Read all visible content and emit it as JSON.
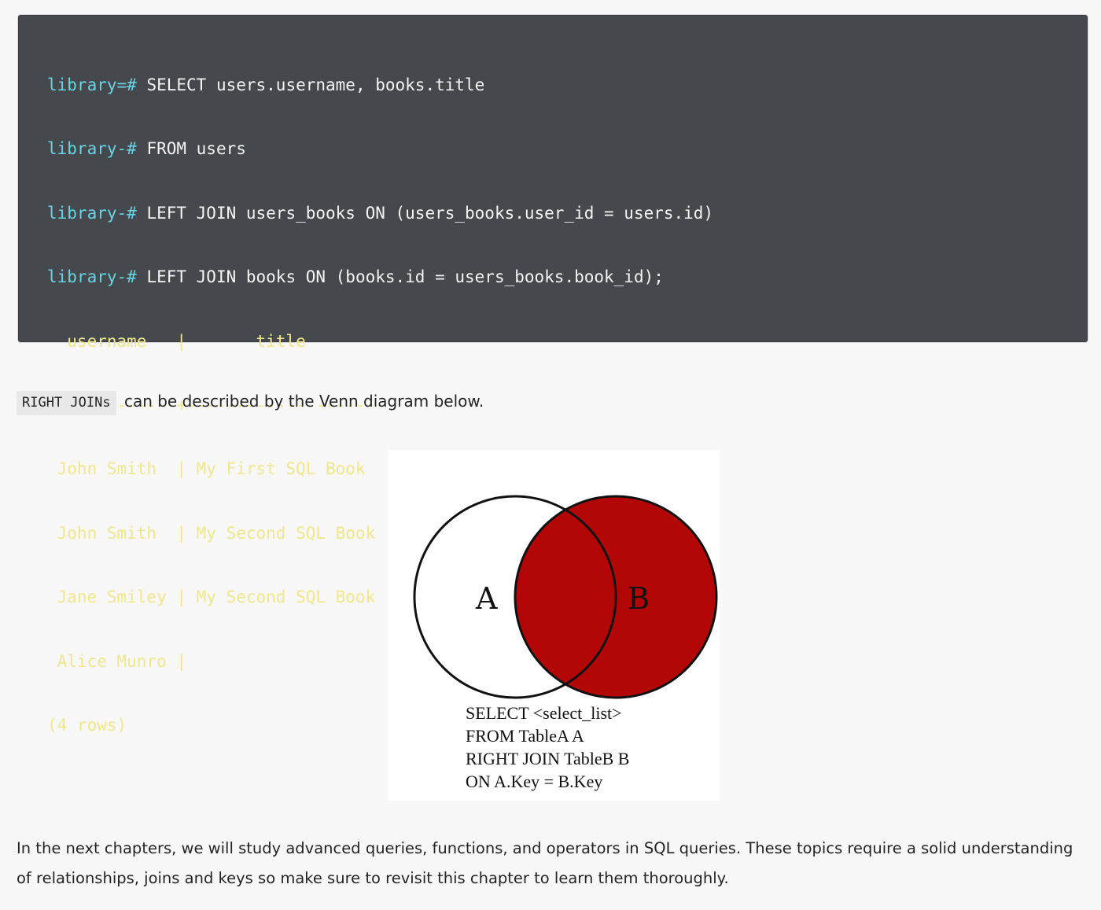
{
  "code_block": {
    "lines": [
      {
        "prompt": "library=#",
        "text": " SELECT users.username, books.title",
        "kind": "sql"
      },
      {
        "prompt": "library-#",
        "text": " FROM users",
        "kind": "sql"
      },
      {
        "prompt": "library-#",
        "text": " LEFT JOIN users_books ON (users_books.user_id = users.id)",
        "kind": "sql"
      },
      {
        "prompt": "library-#",
        "text": " LEFT JOIN books ON (books.id = users_books.book_id);",
        "kind": "sql"
      },
      {
        "prompt": "",
        "text": "  username   |       title",
        "kind": "out"
      },
      {
        "prompt": "",
        "text": "-------------+--------------------",
        "kind": "out"
      },
      {
        "prompt": "",
        "text": " John Smith  | My First SQL Book",
        "kind": "out"
      },
      {
        "prompt": "",
        "text": " John Smith  | My Second SQL Book",
        "kind": "out"
      },
      {
        "prompt": "",
        "text": " Jane Smiley | My Second SQL Book",
        "kind": "out"
      },
      {
        "prompt": "",
        "text": " Alice Munro |",
        "kind": "out"
      },
      {
        "prompt": "",
        "text": "(4 rows)",
        "kind": "out"
      }
    ]
  },
  "intro": {
    "code": "RIGHT JOINs",
    "text": " can be described by the Venn diagram below."
  },
  "venn": {
    "label_a": "A",
    "label_b": "B",
    "fill_color": "#b30606",
    "caption": [
      "SELECT <select_list>",
      "FROM TableA A",
      "RIGHT JOIN TableB B",
      "ON A.Key = B.Key"
    ]
  },
  "outro": {
    "text": "In the next chapters, we will study advanced queries, functions, and operators in SQL queries. These topics require a solid understanding of relationships, joins and keys so make sure to revisit this chapter to learn them thoroughly."
  }
}
